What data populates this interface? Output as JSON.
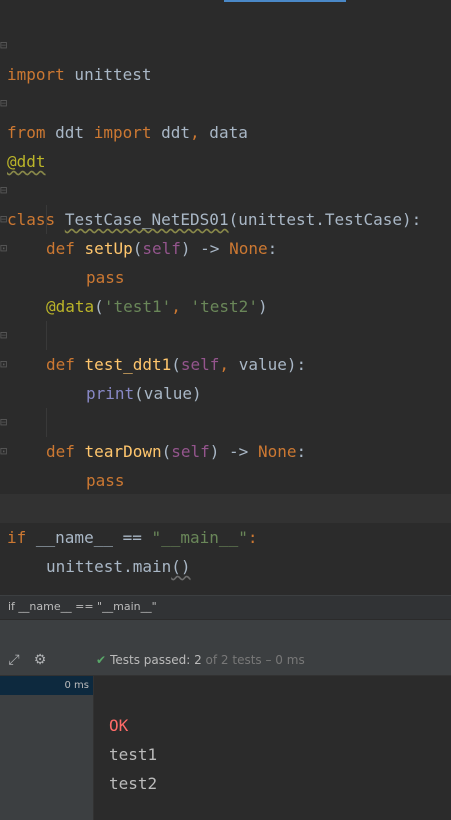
{
  "editor": {
    "lines": {
      "l1": {
        "k": "import",
        "rest": " unittest"
      },
      "l2": {
        "k": "from",
        "a": " ddt ",
        "k2": "import",
        "b": " ddt",
        "comma": ",",
        "c": " data"
      },
      "l3": {
        "dec": "@ddt"
      },
      "l4": {
        "k": "class",
        "sp": " ",
        "name": "TestCase_NetEDS01",
        "rest": "(unittest.TestCase):"
      },
      "l5": {
        "k": "def",
        "sp": " ",
        "fn": "setUp",
        "p1": "(",
        "self": "self",
        "p2": ") -> ",
        "none": "None",
        "p3": ":"
      },
      "l6": {
        "k": "pass"
      },
      "l7": {
        "dec": "@data",
        "p1": "(",
        "s1": "'test1'",
        "comma": ", ",
        "s2": "'test2'",
        "p2": ")"
      },
      "l8": {
        "k": "def",
        "sp": " ",
        "fn": "test_ddt1",
        "p1": "(",
        "self": "self",
        "comma": ", ",
        "arg": "value",
        "p2": "):"
      },
      "l9": {
        "bi": "print",
        "rest": "(value)"
      },
      "l10": {
        "k": "def",
        "sp": " ",
        "fn": "tearDown",
        "p1": "(",
        "self": "self",
        "p2": ") -> ",
        "none": "None",
        "p3": ":"
      },
      "l11": {
        "k": "pass"
      },
      "l12": {
        "k": "if",
        "a": " __name__ == ",
        "str": "\"__main__\"",
        "p": ":"
      },
      "l13": {
        "a": "unittest.main",
        "b": "()"
      }
    }
  },
  "breadcrumb": "if __name__ == \"__main__\"",
  "toolbar": {
    "status_prefix": "Tests passed: ",
    "passed": "2",
    "of_text": " of 2 tests – 0 ms"
  },
  "tree": {
    "duration": "0 ms"
  },
  "console": {
    "ok": "OK",
    "out1": "test1",
    "out2": "test2"
  }
}
